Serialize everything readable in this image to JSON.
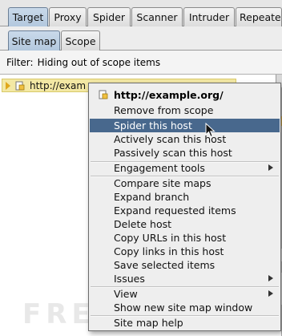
{
  "main_tabs": [
    "Target",
    "Proxy",
    "Spider",
    "Scanner",
    "Intruder",
    "Repeater"
  ],
  "sub_tabs": [
    "Site map",
    "Scope"
  ],
  "filter": {
    "label": "Filter:",
    "text": "Hiding out of scope items"
  },
  "tree": {
    "host_truncated": "http://examp"
  },
  "context_menu": {
    "header": "http://example.org/",
    "items": [
      "Remove from scope",
      "Spider this host",
      "Actively scan this host",
      "Passively scan this host",
      "Engagement tools",
      "Compare site maps",
      "Expand branch",
      "Expand requested items",
      "Delete host",
      "Copy URLs in this host",
      "Copy links in this host",
      "Save selected items",
      "Issues",
      "View",
      "Show new site map window",
      "Site map help"
    ],
    "highlighted": "Spider this host"
  },
  "watermark": "FREEBUF",
  "colors": {
    "active_tab": "#b3c8de",
    "menu_highlight": "#48688d",
    "tree_selection": "#f3e8a4"
  }
}
